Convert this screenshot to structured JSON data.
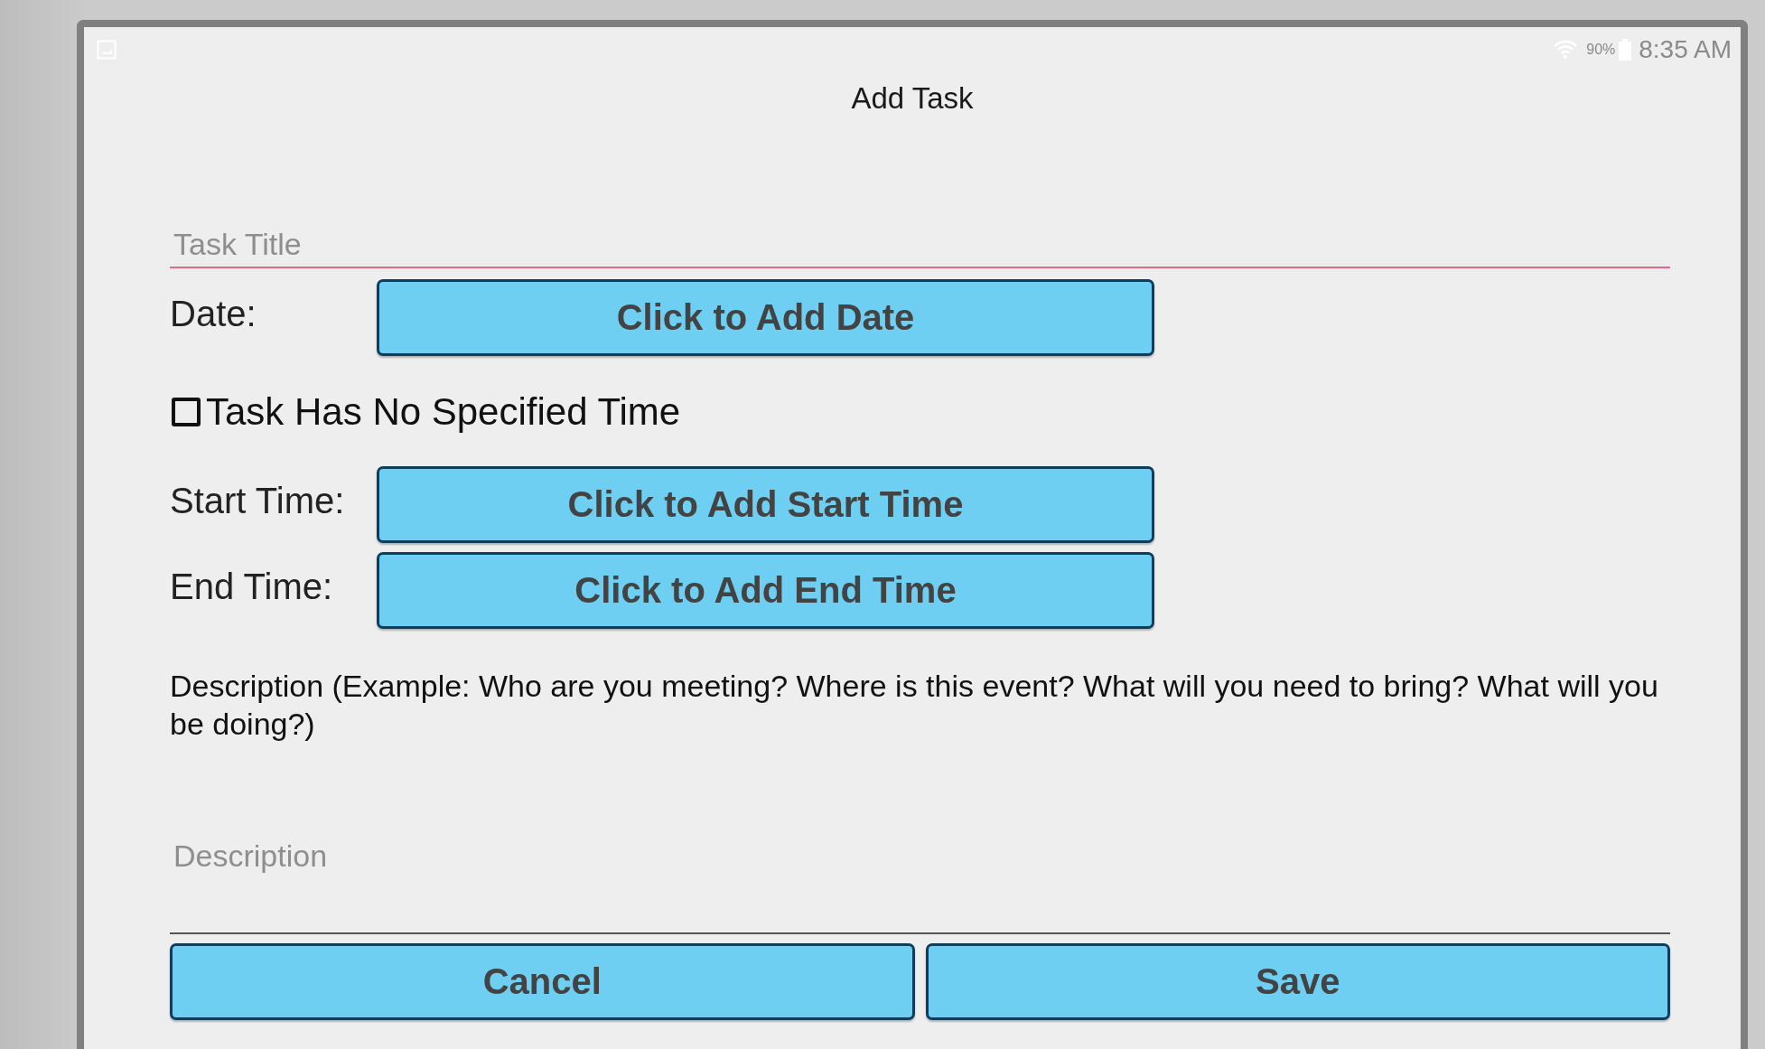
{
  "status_bar": {
    "battery_percent": "90%",
    "time": "8:35 AM"
  },
  "title": "Add Task",
  "task_title": {
    "placeholder": "Task Title"
  },
  "rows": [
    {
      "label": "Date:",
      "button": "Click to Add Date"
    }
  ],
  "no_time": {
    "label": "Task Has No Specified Time",
    "checked": false
  },
  "time_rows": [
    {
      "label": "Start Time:",
      "button": "Click to Add Start Time"
    },
    {
      "label": "End Time:",
      "button": "Click to Add End Time"
    }
  ],
  "description": {
    "label": "Description (Example: Who are you meeting? Where is this event? What will you need to bring? What will you be doing?)",
    "placeholder": "Description"
  },
  "buttons": [
    "Cancel",
    "Save"
  ]
}
